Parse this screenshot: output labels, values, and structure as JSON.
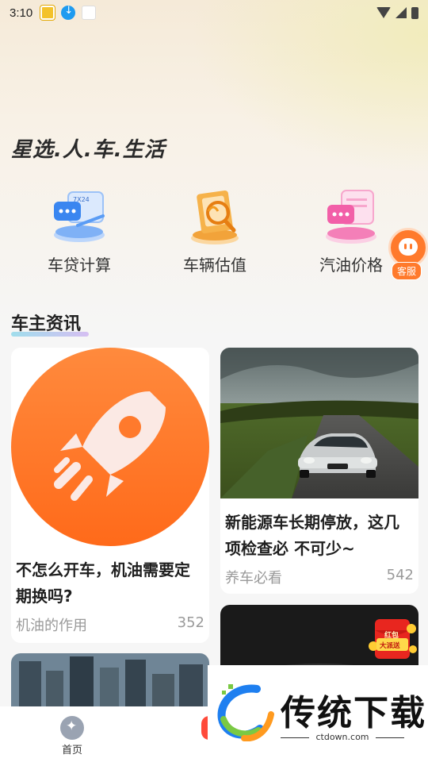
{
  "status_bar": {
    "time": "3:10"
  },
  "slogan": "星选.人.车.生活",
  "features": [
    {
      "label": "车贷计算",
      "icon": "loan-calculator-icon",
      "color": "#3a86f0"
    },
    {
      "label": "车辆估值",
      "icon": "vehicle-valuation-icon",
      "color": "#f29a1e"
    },
    {
      "label": "汽油价格",
      "icon": "gas-price-icon",
      "color": "#f25fa8"
    }
  ],
  "customer_service": {
    "label": "客服"
  },
  "section_title": "车主资讯",
  "articles": [
    {
      "title": "不怎么开车，机油需要定期换吗?",
      "category": "机油的作用",
      "count": "352",
      "image": "rocket-icon"
    },
    {
      "title": "新能源车长期停放，这几项检查必 不可少~",
      "category": "养车必看",
      "count": "542",
      "image": "sports-car-photo"
    }
  ],
  "promo": {
    "label": "红包大派送"
  },
  "bottom_nav": {
    "home_label": "首页"
  },
  "watermark": {
    "brand": "传统下载",
    "url": "ctdown.com"
  },
  "colors": {
    "accent": "#ff7a2c",
    "background": "#f6f6f6"
  }
}
